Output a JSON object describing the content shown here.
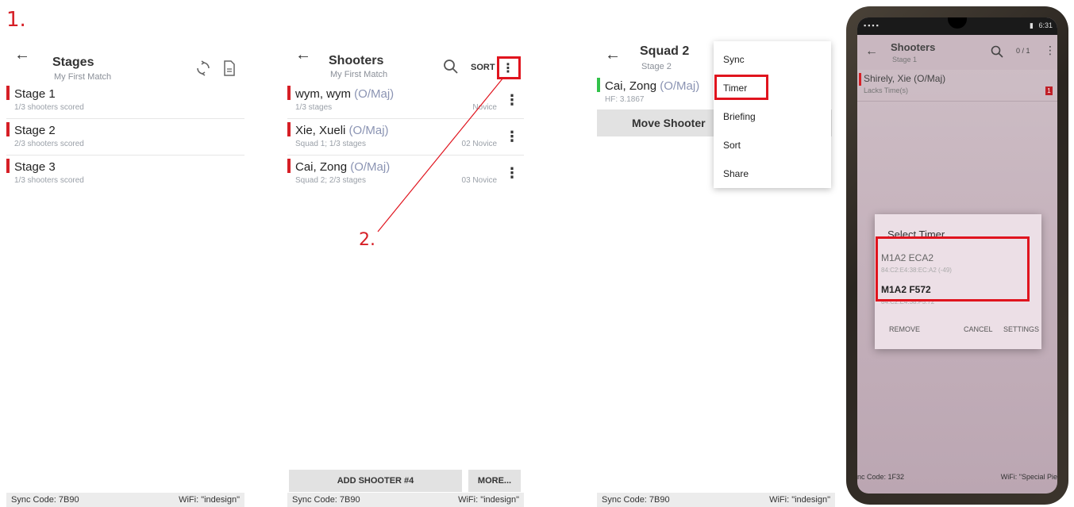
{
  "step_labels": {
    "one": "1.",
    "two": "2."
  },
  "colors": {
    "accent_red": "#d61f26",
    "ok_green": "#32c24a",
    "highlight": "#e0141e"
  },
  "stages_screen": {
    "title": "Stages",
    "subtitle": "My First Match",
    "icons": [
      "sync-icon",
      "document-icon"
    ],
    "items": [
      {
        "title": "Stage 1",
        "sub": "1/3 shooters scored"
      },
      {
        "title": "Stage 2",
        "sub": "2/3 shooters scored"
      },
      {
        "title": "Stage 3",
        "sub": "1/3 shooters scored"
      }
    ],
    "footer": {
      "sync": "Sync Code: 7B90",
      "wifi": "WiFi: \"indesign\""
    }
  },
  "shooters_screen": {
    "title": "Shooters",
    "subtitle": "My First Match",
    "sort_label": "SORT",
    "items": [
      {
        "name": "wym, wym",
        "division": "(O/Maj)",
        "sub": "1/3 stages",
        "right": "Novice"
      },
      {
        "name": "Xie, Xueli",
        "division": "(O/Maj)",
        "sub": "Squad 1; 1/3 stages",
        "right": "02 Novice"
      },
      {
        "name": "Cai, Zong",
        "division": "(O/Maj)",
        "sub": "Squad 2; 2/3 stages",
        "right": "03 Novice"
      }
    ],
    "add_button": "ADD SHOOTER #4",
    "more_button": "MORE...",
    "footer": {
      "sync": "Sync Code: 7B90",
      "wifi": "WiFi: \"indesign\""
    }
  },
  "squad_screen": {
    "title": "Squad 2",
    "subtitle": "Stage 2",
    "item": {
      "name": "Cai, Zong",
      "division": "(O/Maj)",
      "sub": "HF: 3.1867"
    },
    "move_button": "Move Shooter",
    "menu": [
      "Sync",
      "Timer",
      "Briefing",
      "Sort",
      "Share"
    ],
    "footer": {
      "sync": "Sync Code: 7B90",
      "wifi": "WiFi: \"indesign\""
    }
  },
  "phone": {
    "status_time": "6:31",
    "title": "Shooters",
    "subtitle": "Stage 1",
    "counter": "0 / 1",
    "row": {
      "name": "Shirely, Xie (O/Maj)",
      "sub": "Lacks Time(s)",
      "badge": "1"
    },
    "dialog": {
      "title": "Select Timer",
      "timers": [
        {
          "name": "M1A2 ECA2",
          "addr": "84:C2:E4:38:EC:A2 (-49)"
        },
        {
          "name": "M1A2 F572",
          "addr": "84:C2:E4:38:F5:72"
        }
      ],
      "remove": "REMOVE",
      "cancel": "CANCEL",
      "settings": "SETTINGS"
    },
    "footer": {
      "sync": "nc Code: 1F32",
      "wifi": "WiFi: \"Special Pie"
    }
  }
}
